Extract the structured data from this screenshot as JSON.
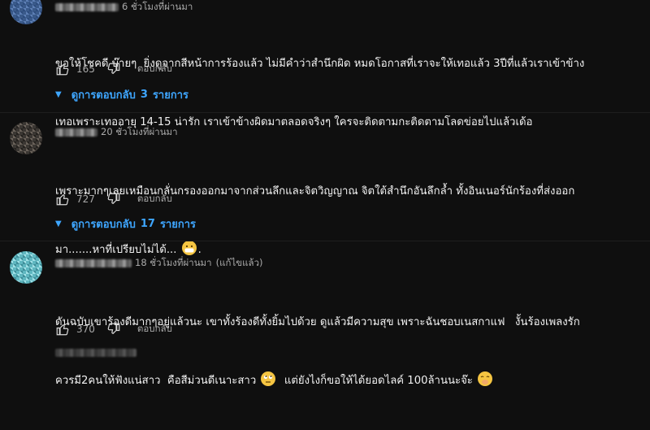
{
  "comments": [
    {
      "time": "6 ชั่วโมงที่ผ่านมา",
      "edited": "",
      "text_line1": "ขอให้โชคดี บ๊ายๆ  ยิ่งดูจากสีหน้าการร้องแล้ว ไม่มีคำว่าสำนึกผิด หมดโอกาสที่เราจะให้เทอแล้ว 3ปีที่แล้วเราเข้าข้าง",
      "text_line2": "เทอเพราะเทออายุ 14-15 น่ารัก เราเข้าข้างผิดมาตลอดจริงๆ ใครจะติดตามกะติดตามโลดข่อยไปแล้วเด้อ",
      "likes": "165",
      "reply_label": "ตอบกลับ",
      "replies_text": "ดูการตอบกลับ",
      "replies_count": "3",
      "replies_unit": "รายการ"
    },
    {
      "time": "20 ชั่วโมงที่ผ่านมา",
      "edited": "",
      "text_line1": "เพราะมากๆเลยเหมือนกลั่นกรองออกมาจากส่วนลึกและจิตวิญญาณ จิตใต้สำนึกอันลึกล้ำ ทั้งอินเนอร์นักร้องที่ส่งออก",
      "text_line2": "มา.......หาที่เปรียบไม่ได้...",
      "text_line2_end": ".",
      "likes": "727",
      "reply_label": "ตอบกลับ",
      "replies_text": "ดูการตอบกลับ",
      "replies_count": "17",
      "replies_unit": "รายการ"
    },
    {
      "time": "18 ชั่วโมงที่ผ่านมา",
      "edited": "(แก้ไขแล้ว)",
      "text_line1": "ดันฉบับเขาร้องดีมากๆอยู่แล้วนะ เขาทั้งร้องดีทั้งยิ้มไปด้วย ดูแล้วมีความสุข เพราะฉันชอบเนสกาแฟ   งั้นร้องเพลงรัก",
      "text_line2_a": "ควรมี2คนให้ฟังแน่สาว  คือสีม่วนดีเนาะสาว",
      "text_line2_b": "  แต่ยังไงก็ขอให้ได้ยอดไลค์ 100ล้านนะจ๊ะ",
      "likes": "370",
      "reply_label": "ตอบกลับ"
    }
  ],
  "icons": {
    "like": "thumbs-up-icon",
    "dislike": "thumbs-down-icon",
    "emoji_mask": "face-with-mask-emoji",
    "emoji_eyeroll": "face-with-rolling-eyes-emoji",
    "emoji_hand": "face-with-hand-over-mouth-emoji"
  },
  "colors": {
    "background": "#0f0f0f",
    "link": "#3ea6ff",
    "muted": "#aaaaaa",
    "text": "#f1f1f1"
  }
}
